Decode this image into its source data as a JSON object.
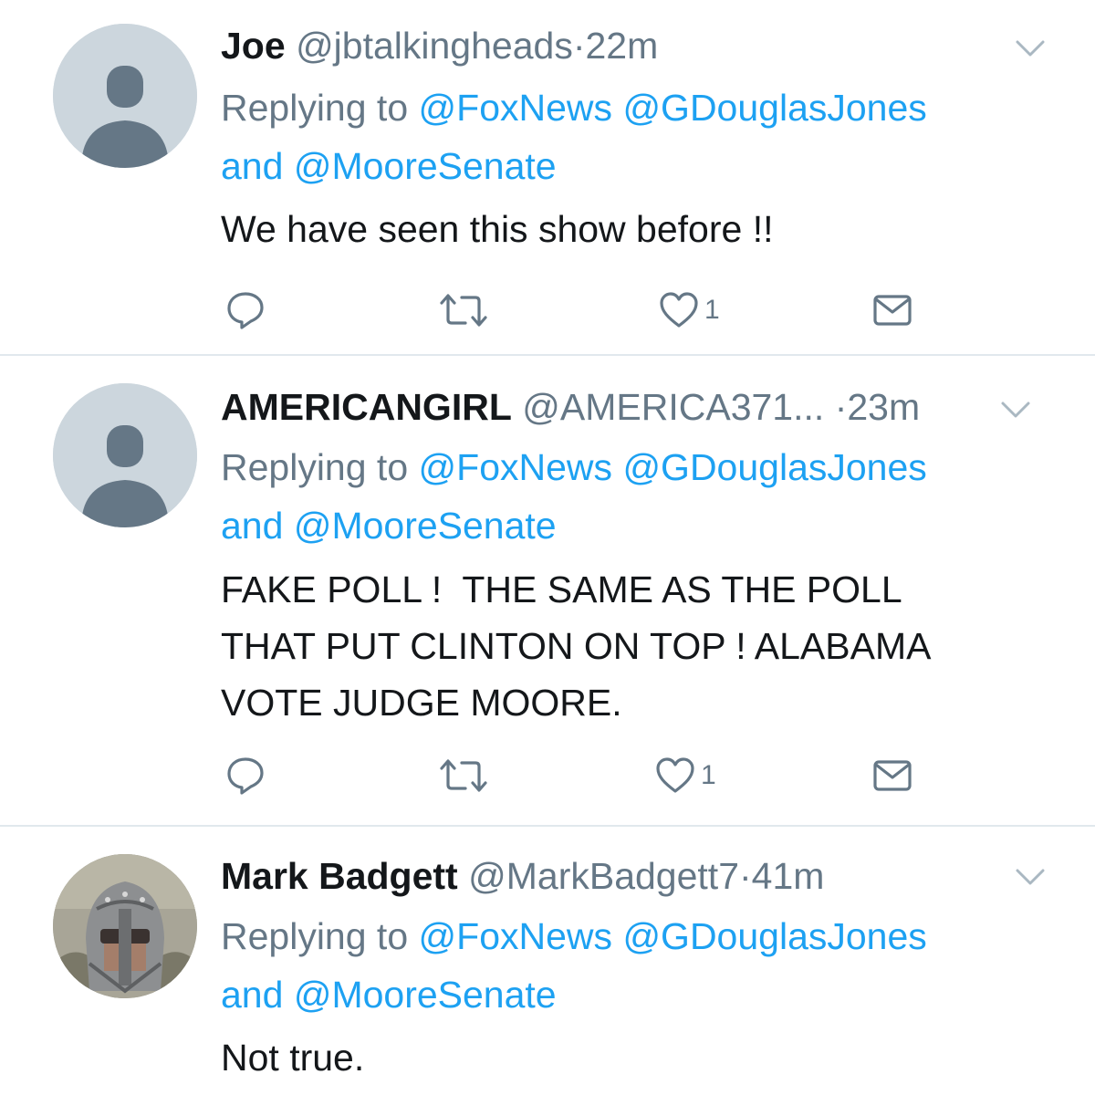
{
  "colors": {
    "link": "#1da1f2",
    "secondary": "#657786",
    "text": "#14171a",
    "divider": "#e1e8ed"
  },
  "tweets": [
    {
      "name": "Joe",
      "handle": "@jbtalkingheads",
      "dot": "·",
      "time": "22m",
      "replying_prefix": "Replying to",
      "mention_1": "@FoxNews",
      "mention_2": "@GDouglasJones",
      "and": "and",
      "mention_3": "@MooreSenate",
      "body_lines": [
        "We have seen this show before !!"
      ],
      "likes": "1",
      "icons": [
        "reply-icon",
        "retweet-icon",
        "heart-icon",
        "mail-icon",
        "chevron-down-icon"
      ]
    },
    {
      "name": "AMERICANGIRL",
      "handle": "@AMERICA371...",
      "dot": "·",
      "time": "23m",
      "replying_prefix": "Replying to",
      "mention_1": "@FoxNews",
      "mention_2": "@GDouglasJones",
      "and": "and",
      "mention_3": "@MooreSenate",
      "body_lines": [
        "FAKE POLL !  THE SAME AS THE POLL",
        "THAT PUT CLINTON ON TOP ! ALABAMA",
        "VOTE JUDGE MOORE."
      ],
      "likes": "1",
      "icons": [
        "reply-icon",
        "retweet-icon",
        "heart-icon",
        "mail-icon",
        "chevron-down-icon"
      ]
    },
    {
      "name": "Mark Badgett",
      "handle": "@MarkBadgett7",
      "dot": "·",
      "time": "41m",
      "replying_prefix": "Replying to",
      "mention_1": "@FoxNews",
      "mention_2": "@GDouglasJones",
      "and": "and",
      "mention_3": "@MooreSenate",
      "body_lines": [
        "Not true."
      ],
      "icons": [
        "chevron-down-icon"
      ]
    }
  ]
}
